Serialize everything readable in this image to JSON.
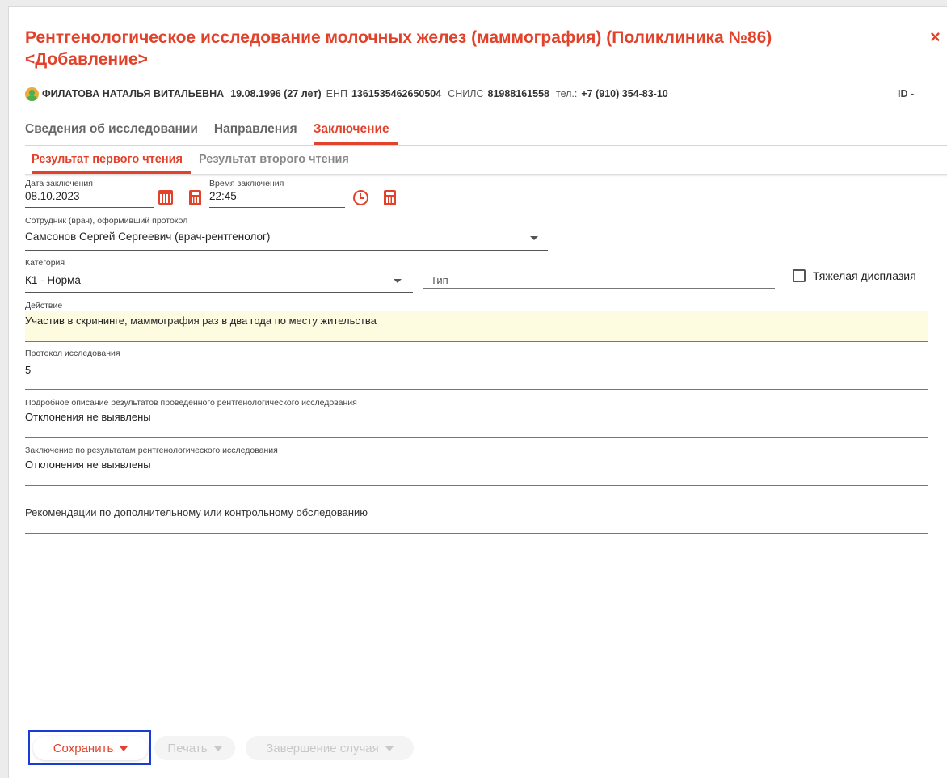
{
  "dialog": {
    "title": "Рентгенологическое исследование молочных желез (маммография) (Поликлиника №86) <Добавление>",
    "close_label": "×"
  },
  "patient": {
    "name": "ФИЛАТОВА НАТАЛЬЯ ВИТАЛЬЕВНА",
    "birth": "19.08.1996 (27 лет)",
    "enp_label": "ЕНП",
    "enp": "1361535462650504",
    "snils_label": "СНИЛС",
    "snils": "81988161558",
    "phone_label": "тел.:",
    "phone": "+7 (910) 354-83-10",
    "id_label": "ID -"
  },
  "tabs": [
    "Сведения об исследовании",
    "Направления",
    "Заключение"
  ],
  "subtabs": [
    "Результат первого чтения",
    "Результат второго чтения"
  ],
  "form": {
    "date_label": "Дата заключения",
    "date_value": "08.10.2023",
    "time_label": "Время заключения",
    "time_value": "22:45",
    "doctor_label": "Сотрудник (врач), оформивший протокол",
    "doctor_value": "Самсонов Сергей Сергеевич (врач-рентгенолог)",
    "category_label": "Категория",
    "category_value": "К1 - Норма",
    "type_placeholder": "Тип",
    "dysplasia_label": "Тяжелая дисплазия",
    "action_label": "Действие",
    "action_value": "Участив в скрининге, маммография раз в два года по месту жительства",
    "protocol_label": "Протокол исследования",
    "protocol_value": "5",
    "description_label": "Подробное описание результатов проведенного рентгенологического исследования",
    "description_value": "Отклонения не выявлены",
    "conclusion_label": "Заключение по результатам рентгенологического исследования",
    "conclusion_value": "Отклонения не выявлены",
    "recommendations_placeholder": "Рекомендации по дополнительному или контрольному обследованию"
  },
  "buttons": {
    "save": "Сохранить",
    "print": "Печать",
    "finish": "Завершение случая"
  },
  "colors": {
    "accent": "#e2412a",
    "highlight": "#fdfbe0",
    "focus": "#1a3bd8"
  }
}
